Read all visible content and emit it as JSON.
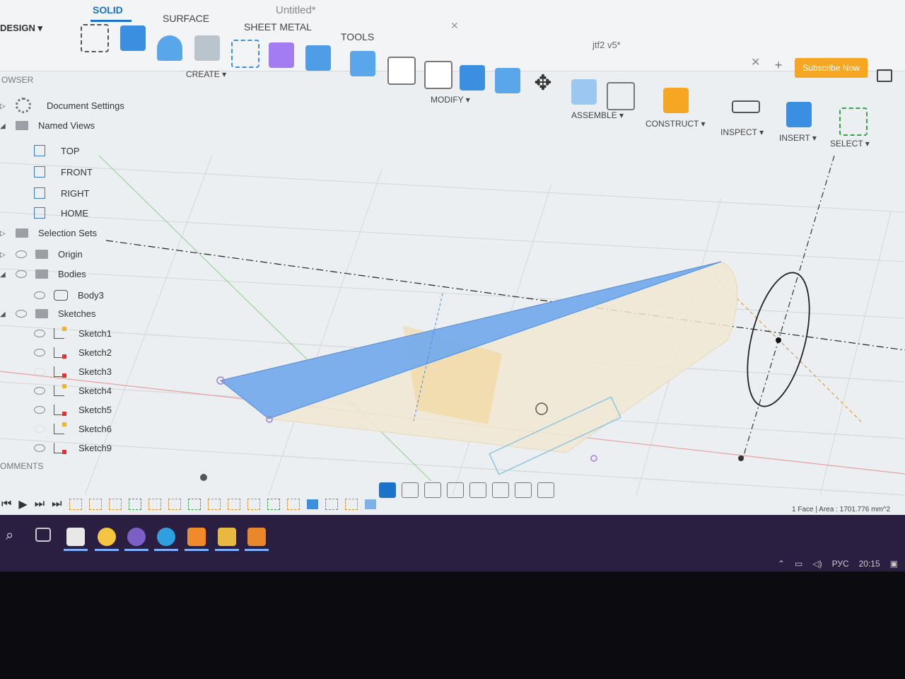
{
  "app": {
    "title": "Untitled*",
    "doc_tab": "jtf2 v5*",
    "subscribe": "Subscribe Now"
  },
  "toolbar": {
    "design": "DESIGN ▾",
    "tabs": [
      "SOLID",
      "SURFACE",
      "SHEET METAL",
      "TOOLS"
    ],
    "groups": {
      "create": "CREATE ▾",
      "modify": "MODIFY ▾",
      "assemble": "ASSEMBLE ▾",
      "construct": "CONSTRUCT ▾",
      "inspect": "INSPECT ▾",
      "insert": "INSERT ▾",
      "select": "SELECT ▾"
    }
  },
  "browser": {
    "header": "OWSER",
    "document_settings": "Document Settings",
    "named_views": "Named Views",
    "views": [
      "TOP",
      "FRONT",
      "RIGHT",
      "HOME"
    ],
    "selection_sets": "Selection Sets",
    "origin": "Origin",
    "bodies": "Bodies",
    "body": "Body3",
    "sketches": "Sketches",
    "sketch_items": [
      "Sketch1",
      "Sketch2",
      "Sketch3",
      "Sketch4",
      "Sketch5",
      "Sketch6",
      "Sketch9"
    ]
  },
  "comments": "OMMENTS",
  "status": "1 Face | Area : 1701.776 mm^2",
  "tray": {
    "lang": "РУС",
    "time": "20:15"
  },
  "colors": {
    "accent": "#1a73c8",
    "face": "#6fa8ee",
    "body": "#f1e8d4",
    "subscribe": "#f5a623",
    "taskbar": "#2a1f40"
  }
}
